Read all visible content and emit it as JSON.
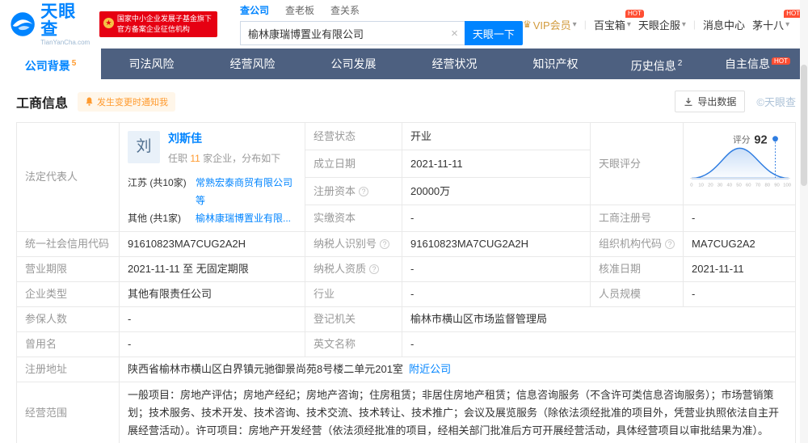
{
  "colors": {
    "accent": "#0084ff",
    "nav_bg": "#4d6080",
    "orange": "#ff9a2e",
    "hot_red": "#ff4e33",
    "gov_red": "#e60012"
  },
  "brand": {
    "logo_text": "天眼查",
    "logo_sub": "TianYanCha.com",
    "gov_line1": "国家中小企业发展子基金旗下",
    "gov_line2": "官方备案企业征信机构"
  },
  "search": {
    "tabs": [
      "查公司",
      "查老板",
      "查关系"
    ],
    "value": "榆林康瑞博置业有限公司",
    "clear_icon": "×",
    "button_label": "天眼一下"
  },
  "usernav": {
    "vip": "VIP会员",
    "treasure": "百宝箱",
    "treasure_hot": "HOT",
    "qifu": "天眼企服",
    "message": "消息中心",
    "username": "茅十八",
    "user_hot": "HOT",
    "crown_icon": "♛",
    "dropdown_icon": "▾"
  },
  "nav": {
    "tabs": [
      {
        "label": "公司背景",
        "count": "5"
      },
      {
        "label": "司法风险"
      },
      {
        "label": "经营风险"
      },
      {
        "label": "公司发展"
      },
      {
        "label": "经营状况"
      },
      {
        "label": "知识产权"
      },
      {
        "label": "历史信息",
        "count": "2"
      },
      {
        "label": "自主信息",
        "hot": "HOT"
      }
    ]
  },
  "section": {
    "title": "工商信息",
    "notify_badge": "发生变更时通知我",
    "export_button": "导出数据",
    "watermark": "©天眼查"
  },
  "legal": {
    "label": "法定代表人",
    "avatar_char": "刘",
    "name": "刘斯佳",
    "serve_prefix": "任职",
    "serve_count": "11",
    "serve_suffix": "家企业，分布如下",
    "regions": [
      {
        "region": "江苏 (共10家)",
        "company": "常熟宏泰商贸有限公司等"
      },
      {
        "region": "其他 (共1家)",
        "company": "榆林康瑞博置业有限..."
      }
    ]
  },
  "score": {
    "label": "天眼评分",
    "caption": "评分",
    "value": "92",
    "ticks": [
      "0",
      "10",
      "20",
      "30",
      "40",
      "50",
      "60",
      "70",
      "80",
      "90",
      "100"
    ]
  },
  "fields": {
    "status_label": "经营状态",
    "status": "开业",
    "established_label": "成立日期",
    "established": "2021-11-11",
    "reg_capital_label": "注册资本",
    "reg_capital": "20000万",
    "paid_capital_label": "实缴资本",
    "paid_capital": "-",
    "reg_no_label": "工商注册号",
    "reg_no": "-",
    "credit_code_label": "统一社会信用代码",
    "credit_code": "91610823MA7CUG2A2H",
    "taxpayer_id_label": "纳税人识别号",
    "taxpayer_id": "91610823MA7CUG2A2H",
    "org_code_label": "组织机构代码",
    "org_code": "MA7CUG2A2",
    "term_label": "营业期限",
    "term": "2021-11-11 至 无固定期限",
    "taxpayer_quality_label": "纳税人资质",
    "taxpayer_quality": "-",
    "approval_label": "核准日期",
    "approval": "2021-11-11",
    "type_label": "企业类型",
    "type": "其他有限责任公司",
    "industry_label": "行业",
    "industry": "-",
    "staff_label": "人员规模",
    "staff": "-",
    "insured_label": "参保人数",
    "insured": "-",
    "authority_label": "登记机关",
    "authority": "榆林市横山区市场监督管理局",
    "former_label": "曾用名",
    "former": "-",
    "english_label": "英文名称",
    "english": "-",
    "address_label": "注册地址",
    "address": "陕西省榆林市横山区白界镇元驰御景尚苑8号楼二单元201室",
    "nearby_link": "附近公司",
    "scope_label": "经营范围",
    "scope": "一般项目：房地产评估；房地产经纪；房地产咨询；住房租赁；非居住房地产租赁；信息咨询服务（不含许可类信息咨询服务）；市场营销策划；技术服务、技术开发、技术咨询、技术交流、技术转让、技术推广；会议及展览服务（除依法须经批准的项目外，凭营业执照依法自主开展经营活动）。许可项目：房地产开发经营（依法须经批准的项目，经相关部门批准后方可开展经营活动，具体经营项目以审批结果为准）。"
  },
  "icons": {
    "info": "?"
  }
}
